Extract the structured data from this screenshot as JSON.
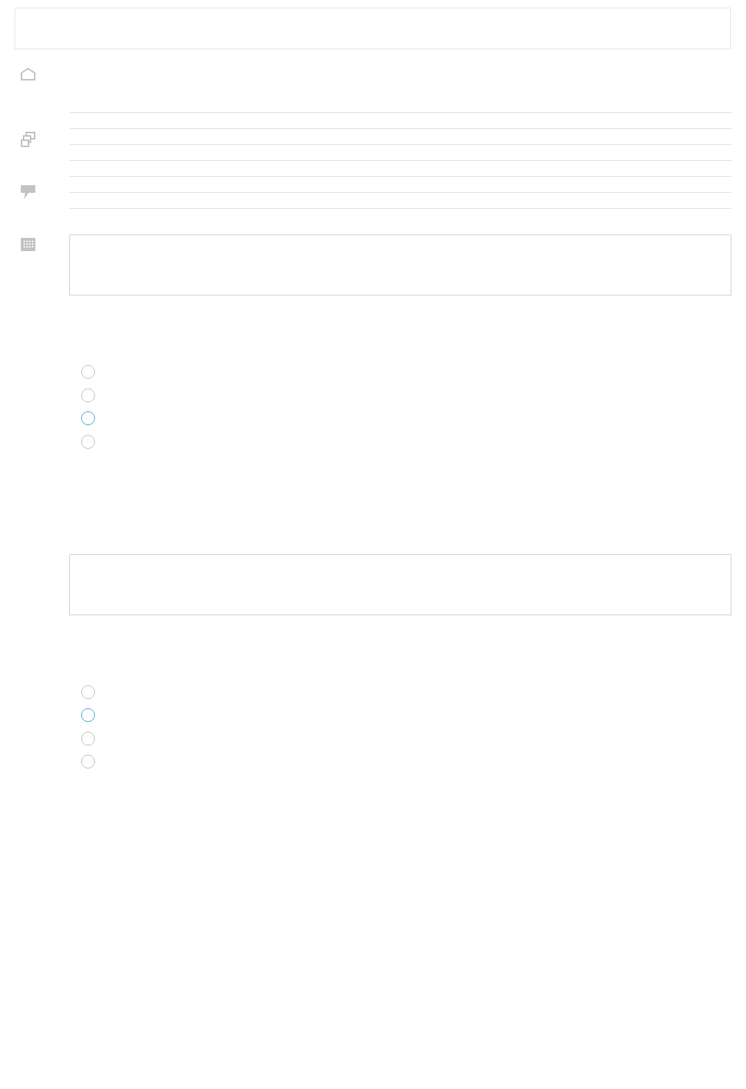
{
  "radio_groups": [
    {
      "options": [
        {
          "color": "#b9b9b9"
        },
        {
          "color": "#b9b9b9"
        },
        {
          "color": "#3a9cc4"
        },
        {
          "color": "#b9b9b9"
        }
      ]
    },
    {
      "options": [
        {
          "color": "#b9b9b9"
        },
        {
          "color": "#3a9cc4"
        },
        {
          "color": "#b9b9b9"
        },
        {
          "color": "#b9b9b9"
        }
      ]
    }
  ]
}
